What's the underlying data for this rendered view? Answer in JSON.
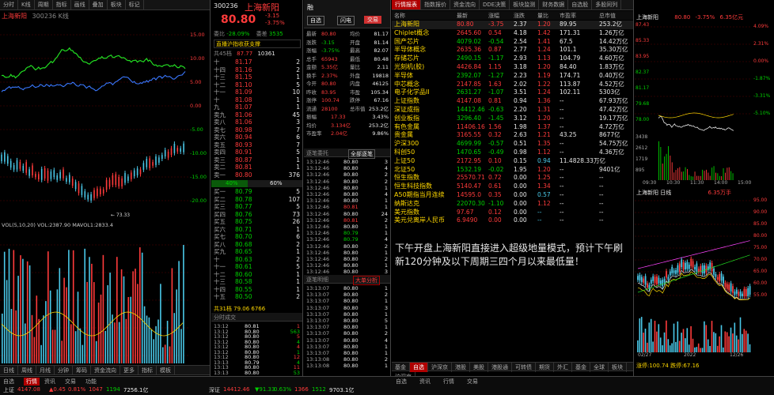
{
  "colors": {
    "up": "#ff3b3b",
    "down": "#00d000",
    "accent": "#b00000",
    "bg": "#000000"
  },
  "left": {
    "top_tabs": [
      "分时",
      "K线",
      "周期",
      "指标",
      "画线",
      "叠加",
      "板块",
      "标记"
    ],
    "title": "上海新阳",
    "sub": "300236 K线",
    "price_labels": [
      "15.00",
      "10.00",
      "5.00",
      "0.00",
      "-5.00",
      "-10.00",
      "-15.00",
      "-20.00"
    ],
    "low_mark": "← 73.33",
    "vol_header": "VOL(5,10,20) VOL:2387.90  MAVOL1:2833.4",
    "bottom_tabs": [
      "日线",
      "周线",
      "月线",
      "分钟",
      "筹码",
      "资金流向",
      "更多",
      "指标",
      "模板"
    ]
  },
  "quote": {
    "code": "300236",
    "name": "上海新阳",
    "price": "80.80",
    "chg": "-3.15",
    "pct": "-3.75%",
    "header_buttons": [
      "融",
      "自选",
      "闪电",
      "交易"
    ],
    "ratio_label": "委比",
    "ratio_val": "-28.09%",
    "diff_label": "委差",
    "diff_val": "3535",
    "notice": "直播沪指收获支撑",
    "total_label": "共45档",
    "total_price": "87.77",
    "total_vol": "10361",
    "asks": [
      [
        "十",
        "81.17",
        "2"
      ],
      [
        "十四",
        "81.16",
        "2"
      ],
      [
        "十三",
        "81.15",
        "1"
      ],
      [
        "十二",
        "81.10",
        "5"
      ],
      [
        "十一",
        "81.09",
        "10"
      ],
      [
        "十",
        "81.08",
        "1"
      ],
      [
        "九",
        "81.07",
        "1"
      ],
      [
        "卖九",
        "81.06",
        "45"
      ],
      [
        "卖八",
        "81.06",
        "3"
      ],
      [
        "卖七",
        "80.98",
        "7"
      ],
      [
        "卖六",
        "80.94",
        "6"
      ],
      [
        "卖五",
        "80.93",
        "7"
      ],
      [
        "卖四",
        "80.91",
        "5"
      ],
      [
        "卖三",
        "80.87",
        "1"
      ],
      [
        "卖二",
        "80.81",
        "1"
      ],
      [
        "卖一",
        "80.80",
        "376"
      ]
    ],
    "split": [
      "40%",
      "60%"
    ],
    "bids": [
      [
        "买一",
        "80.79",
        "5"
      ],
      [
        "买二",
        "80.78",
        "107"
      ],
      [
        "买三",
        "80.77",
        "5"
      ],
      [
        "买四",
        "80.76",
        "73"
      ],
      [
        "买五",
        "80.75",
        "26"
      ],
      [
        "买六",
        "80.71",
        "1"
      ],
      [
        "买七",
        "80.70",
        "6"
      ],
      [
        "买八",
        "80.68",
        "2"
      ],
      [
        "买九",
        "80.65",
        "1"
      ],
      [
        "十",
        "80.63",
        "2"
      ],
      [
        "十一",
        "80.61",
        "5"
      ],
      [
        "十二",
        "80.60",
        "1"
      ],
      [
        "十三",
        "80.58",
        "1"
      ],
      [
        "十四",
        "80.55",
        "1"
      ],
      [
        "十五",
        "80.50",
        "2"
      ]
    ],
    "bid_total": "共31档 79.06 6766",
    "stats": [
      [
        "最新",
        "80.80",
        "均价",
        "81.17"
      ],
      [
        "涨跌",
        "-3.15",
        "开盘",
        "81.14"
      ],
      [
        "涨幅",
        "-3.75%",
        "最高",
        "82.07"
      ],
      [
        "总手",
        "65943",
        "最低",
        "80.48"
      ],
      [
        "金额",
        "5.35亿",
        "量比",
        "2.11"
      ],
      [
        "换手",
        "2.37%",
        "外盘",
        "19818"
      ],
      [
        "今开",
        "80.80",
        "内盘",
        "46125"
      ],
      [
        "昨收",
        "83.95",
        "市盈",
        "105.34"
      ],
      [
        "涨停",
        "100.74",
        "跌停",
        "67.16"
      ],
      [
        "流通",
        "28100",
        "总市值",
        "253.2亿"
      ]
    ],
    "extra": [
      [
        "振幅",
        "17.33",
        "3.43%"
      ],
      [
        "均价",
        "3.134亿",
        "253.2亿"
      ],
      [
        "市盈率",
        "2.04亿",
        "9.86%"
      ]
    ],
    "trades_header": "逐笔成交",
    "trades": [
      [
        "13:12",
        "80.81",
        "1"
      ],
      [
        "13:12",
        "80.80",
        "563"
      ],
      [
        "13:12",
        "80.80",
        "5"
      ],
      [
        "13:12",
        "80.80",
        "4"
      ],
      [
        "13:12",
        "80.80",
        "4"
      ],
      [
        "13:12",
        "80.80",
        "1"
      ],
      [
        "13:12",
        "80.80",
        "12"
      ],
      [
        "13:13",
        "80.79",
        "4"
      ],
      [
        "13:13",
        "80.80",
        "11"
      ],
      [
        "13:13",
        "80.80",
        "53"
      ]
    ],
    "trades_tab": "分时成交"
  },
  "ticks": {
    "header": "逐笔委托",
    "btn": "全部逐笔",
    "rows": [
      [
        "13:12:46",
        "80.80",
        "3"
      ],
      [
        "13:12:46",
        "80.80",
        "4"
      ],
      [
        "13:12:46",
        "80.80",
        "2"
      ],
      [
        "13:12:46",
        "80.80",
        "2"
      ],
      [
        "13:12:46",
        "80.80",
        "1"
      ],
      [
        "13:12:46",
        "80.80",
        "4"
      ],
      [
        "13:12:46",
        "80.80",
        "1"
      ],
      [
        "13:12:46",
        "80.81",
        "1"
      ],
      [
        "13:12:46",
        "80.80",
        "24"
      ],
      [
        "13:12:46",
        "80.81",
        "2"
      ],
      [
        "13:12:46",
        "80.80",
        "1"
      ],
      [
        "13:12:46",
        "80.79",
        "1"
      ],
      [
        "13:12:46",
        "80.79",
        "4"
      ],
      [
        "13:12:46",
        "80.80",
        "2"
      ],
      [
        "13:12:46",
        "80.80",
        "1"
      ],
      [
        "13:12:46",
        "80.80",
        "2"
      ],
      [
        "13:12:46",
        "80.80",
        "1"
      ],
      [
        "13:12:46",
        "80.80",
        "3"
      ]
    ],
    "header2": "逐笔明细",
    "btn2": "大单分析",
    "rows2": [
      [
        "13:13:07",
        "80.80",
        "1"
      ],
      [
        "13:13:07",
        "80.80",
        "2"
      ],
      [
        "13:13:07",
        "80.80",
        "1"
      ],
      [
        "13:13:07",
        "80.80",
        "3"
      ],
      [
        "13:13:07",
        "80.80",
        "1"
      ],
      [
        "13:13:07",
        "80.80",
        "5"
      ],
      [
        "13:13:07",
        "80.80",
        "1"
      ],
      [
        "13:13:07",
        "80.80",
        "2"
      ],
      [
        "13:13:07",
        "80.80",
        "4"
      ],
      [
        "13:13:07",
        "80.80",
        "1"
      ],
      [
        "13:13:07",
        "80.80",
        "1"
      ],
      [
        "13:13:08",
        "80.80",
        "2"
      ],
      [
        "13:13:08",
        "80.80",
        "1"
      ]
    ]
  },
  "watch": {
    "tabs": [
      "行情报表",
      "指数报价",
      "资金流向",
      "DDE决策",
      "板块监测",
      "财务数据",
      "自选股",
      "多股同列"
    ],
    "columns": [
      "名称",
      "最新",
      "涨幅",
      "涨跌",
      "量比",
      "市盈率",
      "总市值"
    ],
    "rows": [
      [
        "上海新阳",
        "80.80",
        "-3.75",
        "2.37",
        "1.20",
        "89.95",
        "253.2亿",
        "r"
      ],
      [
        "Chiplet概念",
        "2645.60",
        "0.54",
        "4.18",
        "1.42",
        "171.31",
        "1.26万亿",
        "r"
      ],
      [
        "国产芯片",
        "4079.02",
        "-0.54",
        "2.54",
        "1.41",
        "67.5",
        "14.42万亿",
        "g"
      ],
      [
        "半导体概念",
        "2635.36",
        "0.87",
        "2.77",
        "1.24",
        "101.1",
        "35.30万亿",
        "r"
      ],
      [
        "存储芯片",
        "2490.15",
        "-1.17",
        "2.93",
        "1.13",
        "104.79",
        "4.60万亿",
        "g"
      ],
      [
        "光刻机(胶)",
        "4426.84",
        "1.15",
        "3.18",
        "1.20",
        "84.40",
        "1.83万亿",
        "r"
      ],
      [
        "半导体",
        "2392.07",
        "-1.27",
        "2.23",
        "1.19",
        "174.71",
        "0.40万亿",
        "g"
      ],
      [
        "中芯概念",
        "2147.85",
        "1.63",
        "2.02",
        "1.22",
        "113.87",
        "4.52万亿",
        "r"
      ],
      [
        "电子化学品II",
        "2631.27",
        "-1.07",
        "3.51",
        "1.24",
        "102.11",
        "5303亿",
        "g"
      ],
      [
        "上证指数",
        "4147.08",
        "0.81",
        "0.94",
        "1.36",
        "--",
        "67.93万亿",
        "r"
      ],
      [
        "深证成指",
        "14412.46",
        "-0.63",
        "2.20",
        "1.31",
        "--",
        "47.42万亿",
        "g"
      ],
      [
        "创业板指",
        "3296.40",
        "-1.45",
        "3.12",
        "1.20",
        "--",
        "19.17万亿",
        "g"
      ],
      [
        "有色金属",
        "11406.16",
        "1.56",
        "1.98",
        "1.37",
        "--",
        "4.72万亿",
        "r"
      ],
      [
        "贵金属",
        "3165.55",
        "0.32",
        "2.63",
        "1.21",
        "43.25",
        "8677亿",
        "r"
      ],
      [
        "沪深300",
        "4699.99",
        "-0.57",
        "0.51",
        "1.35",
        "--",
        "54.75万亿",
        "g"
      ],
      [
        "科创50",
        "1470.65",
        "-0.49",
        "0.98",
        "1.12",
        "--",
        "4.36万亿",
        "g"
      ],
      [
        "上证50",
        "2172.95",
        "0.10",
        "0.15",
        "0.94",
        "11.4828.33万亿",
        "",
        "r"
      ],
      [
        "北证50",
        "1532.19",
        "-0.02",
        "1.95",
        "1.20",
        "--",
        "9401亿",
        "g"
      ],
      [
        "恒生指数",
        "25570.71",
        "0.72",
        "0.00",
        "1.25",
        "--",
        "--",
        "r"
      ],
      [
        "恒生科技指数",
        "5140.47",
        "0.61",
        "0.00",
        "1.34",
        "--",
        "--",
        "r"
      ],
      [
        "A50期指当月连续",
        "14595.0",
        "0.35",
        "0.00",
        "0.57",
        "--",
        "--",
        "r"
      ],
      [
        "纳斯达克",
        "22070.30",
        "-1.10",
        "0.00",
        "1.12",
        "--",
        "--",
        "g"
      ],
      [
        "美元指数",
        "97.67",
        "0.12",
        "0.00",
        "--",
        "--",
        "--",
        "r"
      ],
      [
        "美元兑离岸人民币",
        "6.9490",
        "0.00",
        "0.00",
        "--",
        "--",
        "--",
        "r"
      ]
    ],
    "comment": "下午开盘上海新阳直接进入超级地量模式，预计下午刷新120分钟及以下周期三四个月以来最低量！",
    "bottom_tabs": [
      "基金",
      "自选",
      "沪深京",
      "港股",
      "美股",
      "港股通",
      "可转债",
      "期货",
      "外汇",
      "基金",
      "全球",
      "板块",
      "沪深京"
    ],
    "bottom_active": "自选"
  },
  "mini": {
    "title": "上海新阳",
    "price": "80.80",
    "pct": "-3.75%",
    "amt": "6.35亿元",
    "right_labels": [
      "87.43",
      "85.33",
      "83.95",
      "82.37",
      "81.17",
      "79.68",
      "78.00"
    ],
    "pct_labels": [
      "4.09%",
      "2.31%",
      "0.00%",
      "-1.87%",
      "-3.31%",
      "-5.10%"
    ],
    "vol_labels": [
      "3438",
      "2612",
      "1719",
      "895"
    ],
    "time_labels": [
      "09:30",
      "10:30",
      "11:30",
      "14:00",
      "15:00"
    ],
    "k_title": "上海新阳 日线",
    "k_label": "6.35万手",
    "k_right": [
      "95.00",
      "90.00",
      "85.00",
      "80.00",
      "75.00",
      "70.00",
      "65.00",
      "60.00",
      "55.00"
    ],
    "k_dates": [
      "02/27",
      "2022",
      "12/26"
    ],
    "status": "涨停:100.74 跌停:67.16"
  },
  "statusbar": {
    "items": [
      [
        "上证",
        "4147.08",
        "▲0.45",
        "0.81%",
        "1047",
        "1194",
        "7256.1亿"
      ],
      [
        "深证",
        "14412.46",
        "▼91.33",
        "0.63%",
        "1366",
        "1512",
        "9703.1亿"
      ]
    ],
    "left_tabs": [
      "自选",
      "行情",
      "资讯",
      "交易",
      "功能"
    ],
    "right_tabs": [
      "自选",
      "资讯",
      "行情",
      "交易"
    ]
  }
}
